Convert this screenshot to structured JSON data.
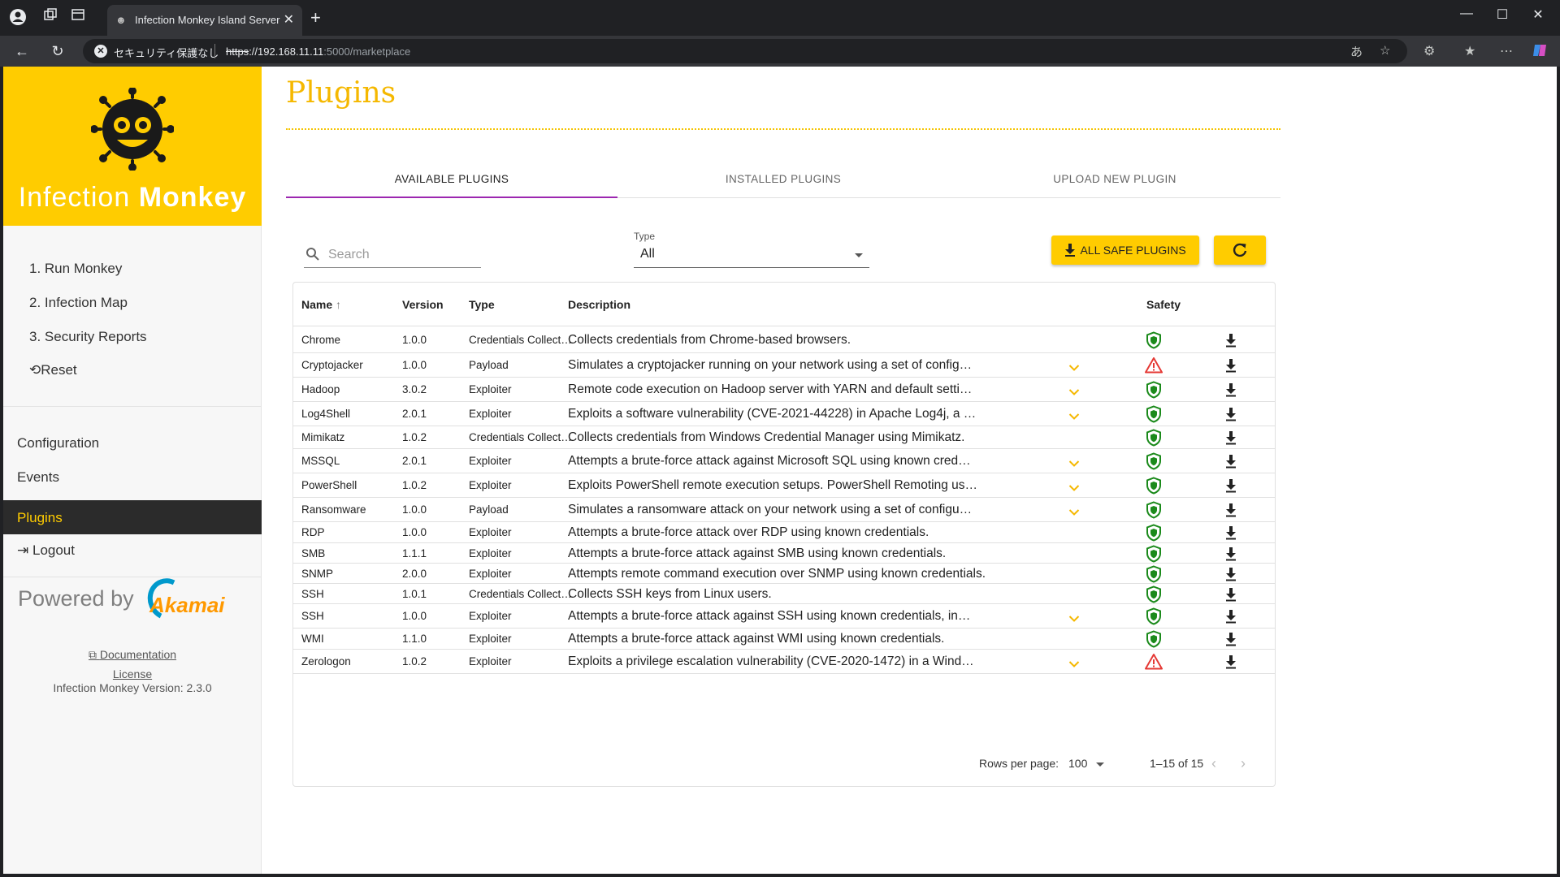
{
  "browser": {
    "tab_title": "Infection Monkey Island Server",
    "security_label": "セキュリティ保護なし",
    "url_protocol": "https",
    "url_host": "://192.168.11.11",
    "url_rest": ":5000/marketplace"
  },
  "sidebar": {
    "logo_word1": "Infection",
    "logo_word2": "Monkey",
    "steps": [
      {
        "label": "1. Run Monkey"
      },
      {
        "label": "2. Infection Map"
      },
      {
        "label": "3. Security Reports"
      }
    ],
    "reset_label": "Reset",
    "items": [
      {
        "label": "Configuration"
      },
      {
        "label": "Events"
      },
      {
        "label": "Plugins"
      },
      {
        "label": "Logout"
      }
    ],
    "powered_by": "Powered by",
    "akamai": "Akamai",
    "documentation": "Documentation",
    "license": "License",
    "version": "Infection Monkey Version: 2.3.0"
  },
  "main": {
    "title": "Plugins",
    "tabs": [
      {
        "label": "AVAILABLE PLUGINS",
        "active": true
      },
      {
        "label": "INSTALLED PLUGINS"
      },
      {
        "label": "UPLOAD NEW PLUGIN"
      }
    ],
    "search_placeholder": "Search",
    "type_label": "Type",
    "type_value": "All",
    "install_all_label": "ALL SAFE PLUGINS",
    "columns": {
      "name": "Name",
      "version": "Version",
      "type": "Type",
      "description": "Description",
      "safety": "Safety"
    },
    "rows": [
      {
        "name": "Chrome",
        "version": "1.0.0",
        "type": "Credentials Collect…",
        "description": "Collects credentials from Chrome-based browsers.",
        "expandable": false,
        "safe": true
      },
      {
        "name": "Cryptojacker",
        "version": "1.0.0",
        "type": "Payload",
        "description": "Simulates a cryptojacker running on your network using a set of config…",
        "expandable": true,
        "safe": false
      },
      {
        "name": "Hadoop",
        "version": "3.0.2",
        "type": "Exploiter",
        "description": "Remote code execution on Hadoop server with YARN and default setti…",
        "expandable": true,
        "safe": true
      },
      {
        "name": "Log4Shell",
        "version": "2.0.1",
        "type": "Exploiter",
        "description": "Exploits a software vulnerability (CVE-2021-44228) in Apache Log4j, a …",
        "expandable": true,
        "safe": true
      },
      {
        "name": "Mimikatz",
        "version": "1.0.2",
        "type": "Credentials Collect…",
        "description": "Collects credentials from Windows Credential Manager using Mimikatz.",
        "expandable": false,
        "safe": true
      },
      {
        "name": "MSSQL",
        "version": "2.0.1",
        "type": "Exploiter",
        "description": "Attempts a brute-force attack against Microsoft SQL using known cred…",
        "expandable": true,
        "safe": true
      },
      {
        "name": "PowerShell",
        "version": "1.0.2",
        "type": "Exploiter",
        "description": "Exploits PowerShell remote execution setups. PowerShell Remoting us…",
        "expandable": true,
        "safe": true
      },
      {
        "name": "Ransomware",
        "version": "1.0.0",
        "type": "Payload",
        "description": "Simulates a ransomware attack on your network using a set of configu…",
        "expandable": true,
        "safe": true
      },
      {
        "name": "RDP",
        "version": "1.0.0",
        "type": "Exploiter",
        "description": "Attempts a brute-force attack over RDP using known credentials.",
        "expandable": false,
        "safe": true
      },
      {
        "name": "SMB",
        "version": "1.1.1",
        "type": "Exploiter",
        "description": "Attempts a brute-force attack against SMB using known credentials.",
        "expandable": false,
        "safe": true
      },
      {
        "name": "SNMP",
        "version": "2.0.0",
        "type": "Exploiter",
        "description": "Attempts remote command execution over SNMP using known credentials.",
        "expandable": false,
        "safe": true
      },
      {
        "name": "SSH",
        "version": "1.0.1",
        "type": "Credentials Collect…",
        "description": "Collects SSH keys from Linux users.",
        "expandable": false,
        "safe": true
      },
      {
        "name": "SSH",
        "version": "1.0.0",
        "type": "Exploiter",
        "description": "Attempts a brute-force attack against SSH using known credentials, in…",
        "expandable": true,
        "safe": true
      },
      {
        "name": "WMI",
        "version": "1.1.0",
        "type": "Exploiter",
        "description": "Attempts a brute-force attack against WMI using known credentials.",
        "expandable": false,
        "safe": true
      },
      {
        "name": "Zerologon",
        "version": "1.0.2",
        "type": "Exploiter",
        "description": "Exploits a privilege escalation vulnerability (CVE-2020-1472) in a Wind…",
        "expandable": true,
        "safe": false
      }
    ],
    "rows_per_page_label": "Rows per page:",
    "rows_per_page": "100",
    "range": "1–15 of 15"
  },
  "colors": {
    "brand_yellow": "#ffcc00",
    "safe_green": "#1b8a1b",
    "unsafe_red": "#e53935",
    "tab_ink": "#9c27b0"
  }
}
